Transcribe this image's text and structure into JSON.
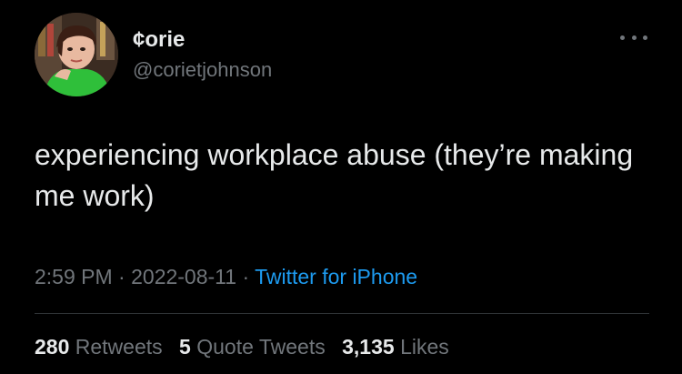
{
  "user": {
    "display_name": "¢orie",
    "handle": "@corietjohnson"
  },
  "tweet": {
    "text": "experiencing workplace abuse (they’re making me work)"
  },
  "meta": {
    "time": "2:59 PM",
    "sep1": " · ",
    "date": "2022-08-11",
    "sep2": " · ",
    "source": "Twitter for iPhone"
  },
  "stats": {
    "retweets_count": "280",
    "retweets_label": "Retweets",
    "quotes_count": "5",
    "quotes_label": "Quote Tweets",
    "likes_count": "3,135",
    "likes_label": "Likes"
  },
  "colors": {
    "background": "#000000",
    "text_primary": "#e7e9ea",
    "text_secondary": "#71767b",
    "link": "#1d9bf0",
    "divider": "#2f3336",
    "avatar_shirt": "#2fbf3a"
  },
  "icons": {
    "more": "more-horizontal-icon"
  }
}
